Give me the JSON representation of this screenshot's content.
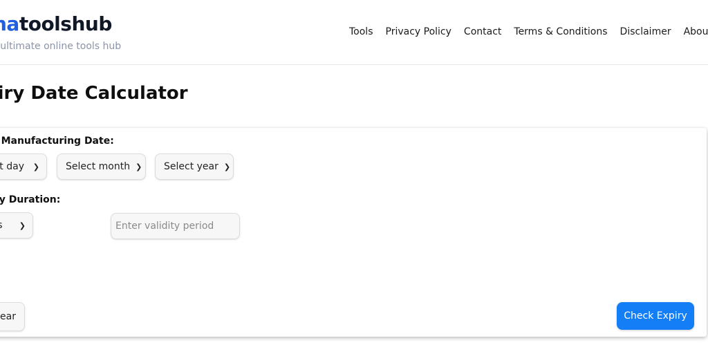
{
  "header": {
    "brand_prefix": "na",
    "brand_suffix": "toolshub",
    "tagline": "r ultimate online tools hub",
    "accent_color": "#1f5fe0",
    "nav": [
      "Tools",
      "Privacy Policy",
      "Contact",
      "Terms & Conditions",
      "Disclaimer",
      "Abou"
    ]
  },
  "main": {
    "title": "piry Date Calculator",
    "mfg_label": "t Manufacturing Date:",
    "day_select": "ect day",
    "month_select": "Select month",
    "year_select": "Select year",
    "validity_label": "ty Duration:",
    "unit_select": "nths",
    "validity_placeholder": "Enter validity period",
    "clear_button": "lear",
    "check_button": "Check Expiry",
    "check_button_color": "#137ef5"
  }
}
